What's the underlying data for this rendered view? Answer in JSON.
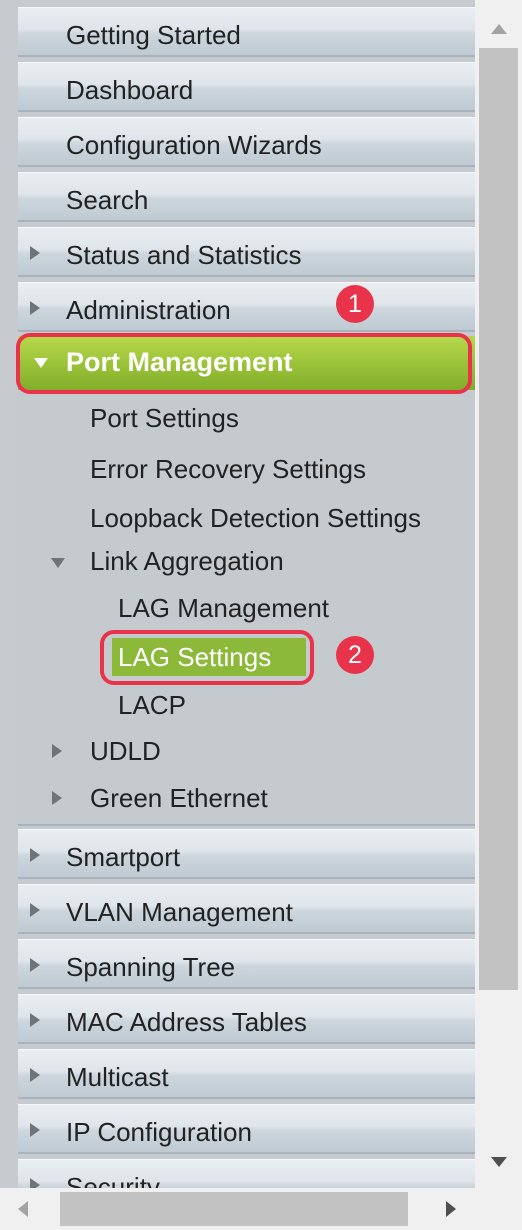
{
  "nav": {
    "items": [
      {
        "label": "Getting Started"
      },
      {
        "label": "Dashboard"
      },
      {
        "label": "Configuration Wizards"
      },
      {
        "label": "Search"
      },
      {
        "label": "Status and Statistics"
      },
      {
        "label": "Administration"
      },
      {
        "label": "Port Management"
      },
      {
        "label": "Smartport"
      },
      {
        "label": "VLAN Management"
      },
      {
        "label": "Spanning Tree"
      },
      {
        "label": "MAC Address Tables"
      },
      {
        "label": "Multicast"
      },
      {
        "label": "IP Configuration"
      },
      {
        "label": "Security"
      }
    ],
    "port_management_children": [
      {
        "label": "Port Settings"
      },
      {
        "label": "Error Recovery Settings"
      },
      {
        "label": "Loopback Detection Settings"
      },
      {
        "label": "Link Aggregation"
      },
      {
        "label": "UDLD"
      },
      {
        "label": "Green Ethernet"
      }
    ],
    "link_aggregation_children": [
      {
        "label": "LAG Management"
      },
      {
        "label": "LAG Settings"
      },
      {
        "label": "LACP"
      }
    ]
  },
  "annotations": {
    "step1": "1",
    "step2": "2"
  },
  "colors": {
    "selected_green": "#9cc43a",
    "annotation_red": "#e8334a"
  },
  "icons": {
    "collapsed": "triangle-right-icon",
    "expanded": "triangle-down-icon"
  }
}
